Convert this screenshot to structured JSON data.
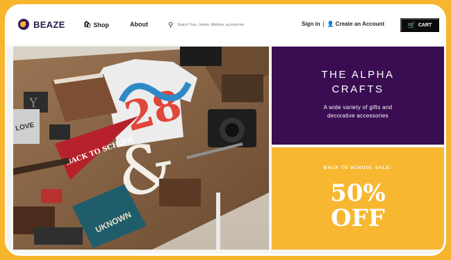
{
  "nav": {
    "brand": "BEAZE",
    "shop_label": "Shop",
    "about_label": "About",
    "search_placeholder": "Search Toys, Jewels, Ribbons, accessories",
    "signin_label": "Sign in",
    "separator": "|",
    "create_account_label": "Create an Account",
    "cart_label": "CART"
  },
  "promo_top": {
    "title_line1": "THE ALPHA",
    "title_line2": "CRAFTS",
    "subtitle_line1": "A wide variety of gifts and",
    "subtitle_line2": "decorative accessories"
  },
  "promo_bottom": {
    "kicker": "BACK TO SCHOOL SALE!",
    "big_line1": "50%",
    "big_line2": "OFF"
  },
  "hero": {
    "pennant_text": "BACK TO SCHOOL",
    "book_text": "UKNOWN",
    "shirt_text": "28",
    "tile_text": "LOVE"
  },
  "colors": {
    "background": "#f7b52e",
    "purple": "#3a0d52",
    "yellow": "#f7b731",
    "cart": "#0c0c0c"
  }
}
